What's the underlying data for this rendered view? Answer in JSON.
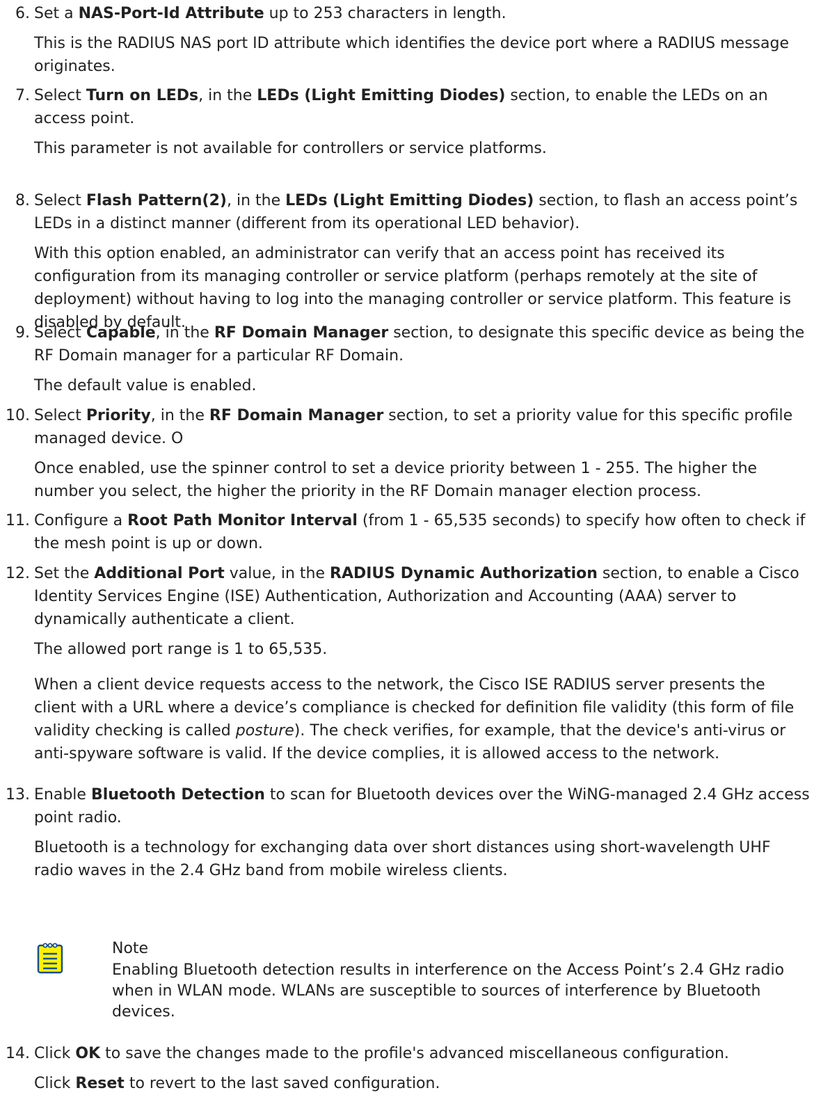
{
  "steps": [
    {
      "number": "6.",
      "lead": [
        {
          "t": "Set a "
        },
        {
          "t": "NAS-Port-Id Attribute",
          "b": 1
        },
        {
          "t": " up to 253 characters in length."
        }
      ],
      "paragraphs": [
        [
          {
            "t": "This is the RADIUS NAS port ID attribute which identifies the device port where a RADIUS message originates."
          }
        ]
      ]
    },
    {
      "number": "7.",
      "lead": [
        {
          "t": "Select "
        },
        {
          "t": "Turn on LEDs",
          "b": 1
        },
        {
          "t": ", in the "
        },
        {
          "t": "LEDs (Light Emitting Diodes)",
          "b": 1
        },
        {
          "t": " section, to enable the LEDs on an access point."
        }
      ],
      "paragraphs": [
        [
          {
            "t": "This parameter is not available for controllers or service platforms."
          }
        ]
      ]
    },
    {
      "number": "8.",
      "lead": [
        {
          "t": "Select "
        },
        {
          "t": "Flash Pattern(2)",
          "b": 1
        },
        {
          "t": ", in the "
        },
        {
          "t": "LEDs (Light Emitting Diodes)",
          "b": 1
        },
        {
          "t": " section, to flash an access point’s LEDs in a distinct manner (different from its operational LED behavior)."
        }
      ],
      "paragraphs": [
        [
          {
            "t": "With this option enabled, an administrator can verify that an access point has received its configuration from its managing controller or service platform (perhaps remotely at the site of deployment) without having to log into the managing controller or service platform. This feature is disabled by default."
          }
        ]
      ]
    },
    {
      "number": "9.",
      "lead": [
        {
          "t": "Select "
        },
        {
          "t": "Capable",
          "b": 1
        },
        {
          "t": ", in the "
        },
        {
          "t": "RF Domain Manager",
          "b": 1
        },
        {
          "t": " section, to designate this specific device as being the RF Domain manager for a particular RF Domain."
        }
      ],
      "paragraphs": [
        [
          {
            "t": "The default value is enabled."
          }
        ]
      ]
    },
    {
      "number": "10.",
      "lead": [
        {
          "t": "Select "
        },
        {
          "t": "Priority",
          "b": 1
        },
        {
          "t": ", in the "
        },
        {
          "t": "RF Domain Manager",
          "b": 1
        },
        {
          "t": " section, to set a priority value for this specific profile managed device. O"
        }
      ],
      "paragraphs": [
        [
          {
            "t": "Once enabled, use the spinner control to set a device priority between 1 - 255. The higher the number you select, the higher the priority in the RF Domain manager election process."
          }
        ]
      ]
    },
    {
      "number": "11.",
      "lead": [
        {
          "t": "Configure a "
        },
        {
          "t": "Root Path Monitor Interval",
          "b": 1
        },
        {
          "t": " (from 1 - 65,535 seconds) to specify how often to check if the mesh point is up or down."
        }
      ],
      "paragraphs": []
    },
    {
      "number": "12.",
      "lead": [
        {
          "t": "Set the "
        },
        {
          "t": "Additional Port",
          "b": 1
        },
        {
          "t": " value, in the "
        },
        {
          "t": "RADIUS Dynamic Authorization",
          "b": 1
        },
        {
          "t": " section, to enable a Cisco Identity Services Engine (ISE) Authentication, Authorization and Accounting (AAA) server to dynamically authenticate a client."
        }
      ],
      "paragraphs": [
        [
          {
            "t": "The allowed port range is 1 to 65,535."
          }
        ],
        [
          {
            "t": "When a client device requests access to the network, the Cisco ISE RADIUS server presents the client with a URL where a device’s compliance is checked for definition file validity (this form of file validity checking is called "
          },
          {
            "t": "posture",
            "i": 1
          },
          {
            "t": "). The check verifies, for example, that the device's anti-virus or anti-spyware software is valid. If the device complies, it is allowed access to the network."
          }
        ]
      ]
    },
    {
      "number": "13.",
      "lead": [
        {
          "t": "Enable "
        },
        {
          "t": "Bluetooth Detection",
          "b": 1
        },
        {
          "t": " to scan for Bluetooth devices over the WiNG-managed 2.4 GHz access point radio."
        }
      ],
      "paragraphs": [
        [
          {
            "t": "Bluetooth is a technology for exchanging data over short distances using short-wavelength UHF radio waves in the 2.4 GHz band from mobile wireless clients."
          }
        ]
      ]
    },
    {
      "number": "14.",
      "lead": [
        {
          "t": "Click "
        },
        {
          "t": "OK",
          "b": 1
        },
        {
          "t": " to save the changes made to the profile's advanced miscellaneous configuration."
        }
      ],
      "paragraphs": [
        [
          {
            "t": "Click "
          },
          {
            "t": "Reset",
            "b": 1
          },
          {
            "t": " to revert to the last saved configuration."
          }
        ]
      ]
    }
  ],
  "note": {
    "icon": "note-icon",
    "title": "Note",
    "text": "Enabling Bluetooth detection results in interference on the Access Point’s 2.4 GHz radio when in WLAN mode. WLANs are susceptible to sources of interference by Bluetooth devices."
  },
  "colors": {
    "text": "#222222",
    "note_icon_fill": "#fff200",
    "note_icon_stroke": "#1a4f8b"
  }
}
